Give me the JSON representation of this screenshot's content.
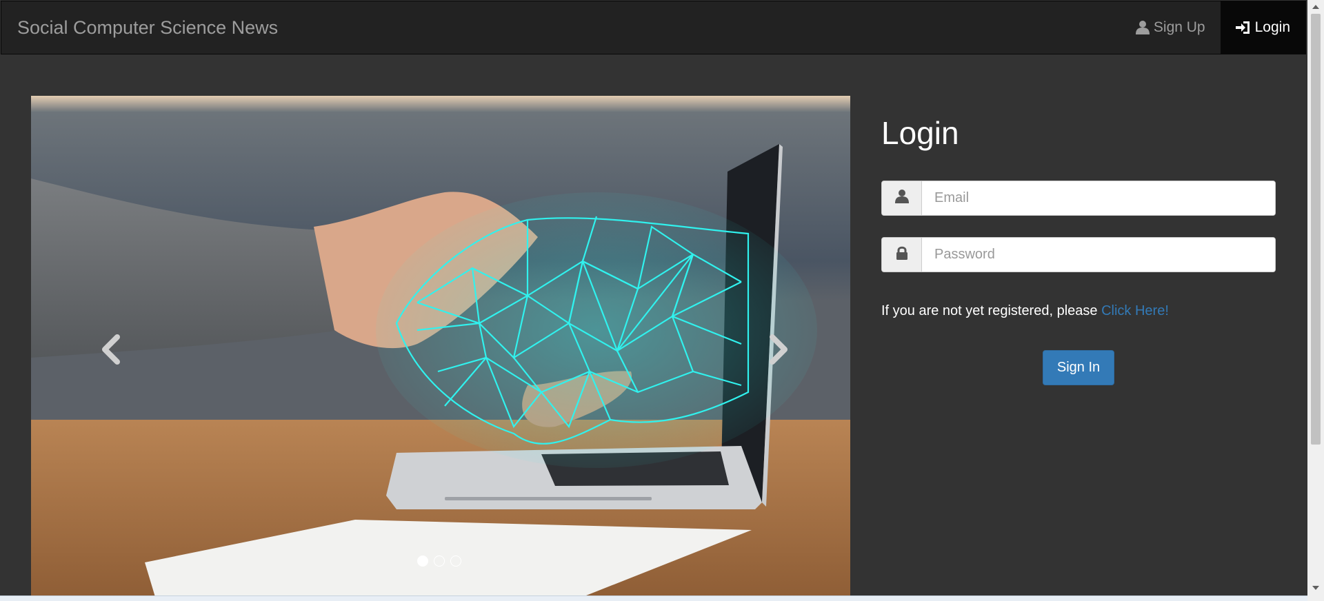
{
  "navbar": {
    "brand": "Social Computer Science News",
    "signup_label": "Sign Up",
    "login_label": "Login"
  },
  "carousel": {
    "slide_count": 3,
    "active_index": 0,
    "image_subject": "hand shaking a glowing wireframe hand emerging from a laptop"
  },
  "login": {
    "title": "Login",
    "email_placeholder": "Email",
    "password_placeholder": "Password",
    "register_text": "If you are not yet registered, please ",
    "register_link": "Click Here!",
    "signin_label": "Sign In"
  },
  "colors": {
    "page_bg": "#333333",
    "navbar_bg": "#222222",
    "active_nav_bg": "#080808",
    "link": "#337ab7",
    "button": "#337ab7",
    "wireframe": "#30f2ee"
  },
  "icons": {
    "signup": "user-icon",
    "login": "login-icon",
    "email": "user-icon",
    "password": "lock-icon",
    "prev": "chevron-left-icon",
    "next": "chevron-right-icon"
  }
}
